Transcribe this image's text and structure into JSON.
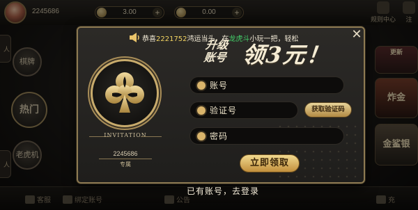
{
  "lobby": {
    "player_id": "2245686",
    "currencies": [
      "3.00",
      "0.00"
    ],
    "top_right": [
      "规则中心",
      "注"
    ],
    "left_buttons": [
      "棋牌",
      "热门",
      "老虎机"
    ],
    "left_stubs": [
      "人",
      "人"
    ],
    "right_cards": [
      "更新",
      "炸金",
      "金鲨银"
    ],
    "bottom": [
      "客服",
      "绑定账号",
      "公告",
      "充"
    ]
  },
  "marquee": {
    "prefix": "恭喜",
    "user": "2221752",
    "middle": "鸿运当头，在",
    "game": "龙虎斗",
    "suffix": "小玩一把，轻松"
  },
  "emblem": {
    "invitation": "INVITATION",
    "id": "2245686",
    "tag": "专属"
  },
  "promo": {
    "line1": "升级",
    "line2": "账号",
    "headline": "领3元！"
  },
  "form": {
    "account_placeholder": "账号",
    "code_placeholder": "验证号",
    "password_placeholder": "密码",
    "get_code_label": "获取验证码",
    "submit_label": "立即领取"
  },
  "login_link": "已有账号，去登录",
  "colors": {
    "accent_gold": "#c8ab6c",
    "marquee_name": "#f2d462",
    "marquee_game": "#43d06a"
  }
}
